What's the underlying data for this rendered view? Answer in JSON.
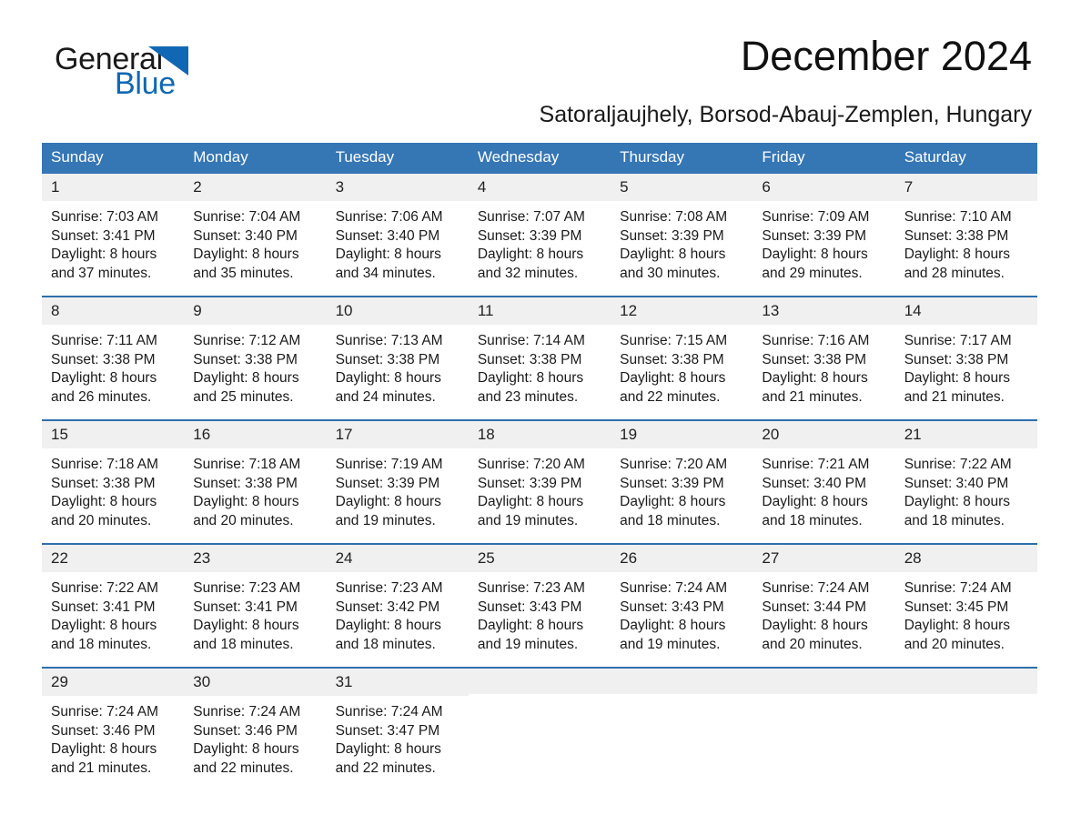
{
  "brand": {
    "name_part1": "General",
    "name_part2": "Blue",
    "triangle_color": "#1068b4"
  },
  "header": {
    "month_title": "December 2024",
    "location": "Satoraljaujhely, Borsod-Abauj-Zemplen, Hungary"
  },
  "theme": {
    "header_blue": "#3576b5",
    "rule_blue": "#2f6fad",
    "daynum_band": "#f0f0f0",
    "text": "#1b1b1b"
  },
  "calendar": {
    "weekday_headers": [
      "Sunday",
      "Monday",
      "Tuesday",
      "Wednesday",
      "Thursday",
      "Friday",
      "Saturday"
    ],
    "weeks": [
      [
        {
          "day": "1",
          "sunrise": "Sunrise: 7:03 AM",
          "sunset": "Sunset: 3:41 PM",
          "daylight_line1": "Daylight: 8 hours",
          "daylight_line2": "and 37 minutes."
        },
        {
          "day": "2",
          "sunrise": "Sunrise: 7:04 AM",
          "sunset": "Sunset: 3:40 PM",
          "daylight_line1": "Daylight: 8 hours",
          "daylight_line2": "and 35 minutes."
        },
        {
          "day": "3",
          "sunrise": "Sunrise: 7:06 AM",
          "sunset": "Sunset: 3:40 PM",
          "daylight_line1": "Daylight: 8 hours",
          "daylight_line2": "and 34 minutes."
        },
        {
          "day": "4",
          "sunrise": "Sunrise: 7:07 AM",
          "sunset": "Sunset: 3:39 PM",
          "daylight_line1": "Daylight: 8 hours",
          "daylight_line2": "and 32 minutes."
        },
        {
          "day": "5",
          "sunrise": "Sunrise: 7:08 AM",
          "sunset": "Sunset: 3:39 PM",
          "daylight_line1": "Daylight: 8 hours",
          "daylight_line2": "and 30 minutes."
        },
        {
          "day": "6",
          "sunrise": "Sunrise: 7:09 AM",
          "sunset": "Sunset: 3:39 PM",
          "daylight_line1": "Daylight: 8 hours",
          "daylight_line2": "and 29 minutes."
        },
        {
          "day": "7",
          "sunrise": "Sunrise: 7:10 AM",
          "sunset": "Sunset: 3:38 PM",
          "daylight_line1": "Daylight: 8 hours",
          "daylight_line2": "and 28 minutes."
        }
      ],
      [
        {
          "day": "8",
          "sunrise": "Sunrise: 7:11 AM",
          "sunset": "Sunset: 3:38 PM",
          "daylight_line1": "Daylight: 8 hours",
          "daylight_line2": "and 26 minutes."
        },
        {
          "day": "9",
          "sunrise": "Sunrise: 7:12 AM",
          "sunset": "Sunset: 3:38 PM",
          "daylight_line1": "Daylight: 8 hours",
          "daylight_line2": "and 25 minutes."
        },
        {
          "day": "10",
          "sunrise": "Sunrise: 7:13 AM",
          "sunset": "Sunset: 3:38 PM",
          "daylight_line1": "Daylight: 8 hours",
          "daylight_line2": "and 24 minutes."
        },
        {
          "day": "11",
          "sunrise": "Sunrise: 7:14 AM",
          "sunset": "Sunset: 3:38 PM",
          "daylight_line1": "Daylight: 8 hours",
          "daylight_line2": "and 23 minutes."
        },
        {
          "day": "12",
          "sunrise": "Sunrise: 7:15 AM",
          "sunset": "Sunset: 3:38 PM",
          "daylight_line1": "Daylight: 8 hours",
          "daylight_line2": "and 22 minutes."
        },
        {
          "day": "13",
          "sunrise": "Sunrise: 7:16 AM",
          "sunset": "Sunset: 3:38 PM",
          "daylight_line1": "Daylight: 8 hours",
          "daylight_line2": "and 21 minutes."
        },
        {
          "day": "14",
          "sunrise": "Sunrise: 7:17 AM",
          "sunset": "Sunset: 3:38 PM",
          "daylight_line1": "Daylight: 8 hours",
          "daylight_line2": "and 21 minutes."
        }
      ],
      [
        {
          "day": "15",
          "sunrise": "Sunrise: 7:18 AM",
          "sunset": "Sunset: 3:38 PM",
          "daylight_line1": "Daylight: 8 hours",
          "daylight_line2": "and 20 minutes."
        },
        {
          "day": "16",
          "sunrise": "Sunrise: 7:18 AM",
          "sunset": "Sunset: 3:38 PM",
          "daylight_line1": "Daylight: 8 hours",
          "daylight_line2": "and 20 minutes."
        },
        {
          "day": "17",
          "sunrise": "Sunrise: 7:19 AM",
          "sunset": "Sunset: 3:39 PM",
          "daylight_line1": "Daylight: 8 hours",
          "daylight_line2": "and 19 minutes."
        },
        {
          "day": "18",
          "sunrise": "Sunrise: 7:20 AM",
          "sunset": "Sunset: 3:39 PM",
          "daylight_line1": "Daylight: 8 hours",
          "daylight_line2": "and 19 minutes."
        },
        {
          "day": "19",
          "sunrise": "Sunrise: 7:20 AM",
          "sunset": "Sunset: 3:39 PM",
          "daylight_line1": "Daylight: 8 hours",
          "daylight_line2": "and 18 minutes."
        },
        {
          "day": "20",
          "sunrise": "Sunrise: 7:21 AM",
          "sunset": "Sunset: 3:40 PM",
          "daylight_line1": "Daylight: 8 hours",
          "daylight_line2": "and 18 minutes."
        },
        {
          "day": "21",
          "sunrise": "Sunrise: 7:22 AM",
          "sunset": "Sunset: 3:40 PM",
          "daylight_line1": "Daylight: 8 hours",
          "daylight_line2": "and 18 minutes."
        }
      ],
      [
        {
          "day": "22",
          "sunrise": "Sunrise: 7:22 AM",
          "sunset": "Sunset: 3:41 PM",
          "daylight_line1": "Daylight: 8 hours",
          "daylight_line2": "and 18 minutes."
        },
        {
          "day": "23",
          "sunrise": "Sunrise: 7:23 AM",
          "sunset": "Sunset: 3:41 PM",
          "daylight_line1": "Daylight: 8 hours",
          "daylight_line2": "and 18 minutes."
        },
        {
          "day": "24",
          "sunrise": "Sunrise: 7:23 AM",
          "sunset": "Sunset: 3:42 PM",
          "daylight_line1": "Daylight: 8 hours",
          "daylight_line2": "and 18 minutes."
        },
        {
          "day": "25",
          "sunrise": "Sunrise: 7:23 AM",
          "sunset": "Sunset: 3:43 PM",
          "daylight_line1": "Daylight: 8 hours",
          "daylight_line2": "and 19 minutes."
        },
        {
          "day": "26",
          "sunrise": "Sunrise: 7:24 AM",
          "sunset": "Sunset: 3:43 PM",
          "daylight_line1": "Daylight: 8 hours",
          "daylight_line2": "and 19 minutes."
        },
        {
          "day": "27",
          "sunrise": "Sunrise: 7:24 AM",
          "sunset": "Sunset: 3:44 PM",
          "daylight_line1": "Daylight: 8 hours",
          "daylight_line2": "and 20 minutes."
        },
        {
          "day": "28",
          "sunrise": "Sunrise: 7:24 AM",
          "sunset": "Sunset: 3:45 PM",
          "daylight_line1": "Daylight: 8 hours",
          "daylight_line2": "and 20 minutes."
        }
      ],
      [
        {
          "day": "29",
          "sunrise": "Sunrise: 7:24 AM",
          "sunset": "Sunset: 3:46 PM",
          "daylight_line1": "Daylight: 8 hours",
          "daylight_line2": "and 21 minutes."
        },
        {
          "day": "30",
          "sunrise": "Sunrise: 7:24 AM",
          "sunset": "Sunset: 3:46 PM",
          "daylight_line1": "Daylight: 8 hours",
          "daylight_line2": "and 22 minutes."
        },
        {
          "day": "31",
          "sunrise": "Sunrise: 7:24 AM",
          "sunset": "Sunset: 3:47 PM",
          "daylight_line1": "Daylight: 8 hours",
          "daylight_line2": "and 22 minutes."
        },
        {
          "day": "",
          "sunrise": "",
          "sunset": "",
          "daylight_line1": "",
          "daylight_line2": ""
        },
        {
          "day": "",
          "sunrise": "",
          "sunset": "",
          "daylight_line1": "",
          "daylight_line2": ""
        },
        {
          "day": "",
          "sunrise": "",
          "sunset": "",
          "daylight_line1": "",
          "daylight_line2": ""
        },
        {
          "day": "",
          "sunrise": "",
          "sunset": "",
          "daylight_line1": "",
          "daylight_line2": ""
        }
      ]
    ]
  }
}
